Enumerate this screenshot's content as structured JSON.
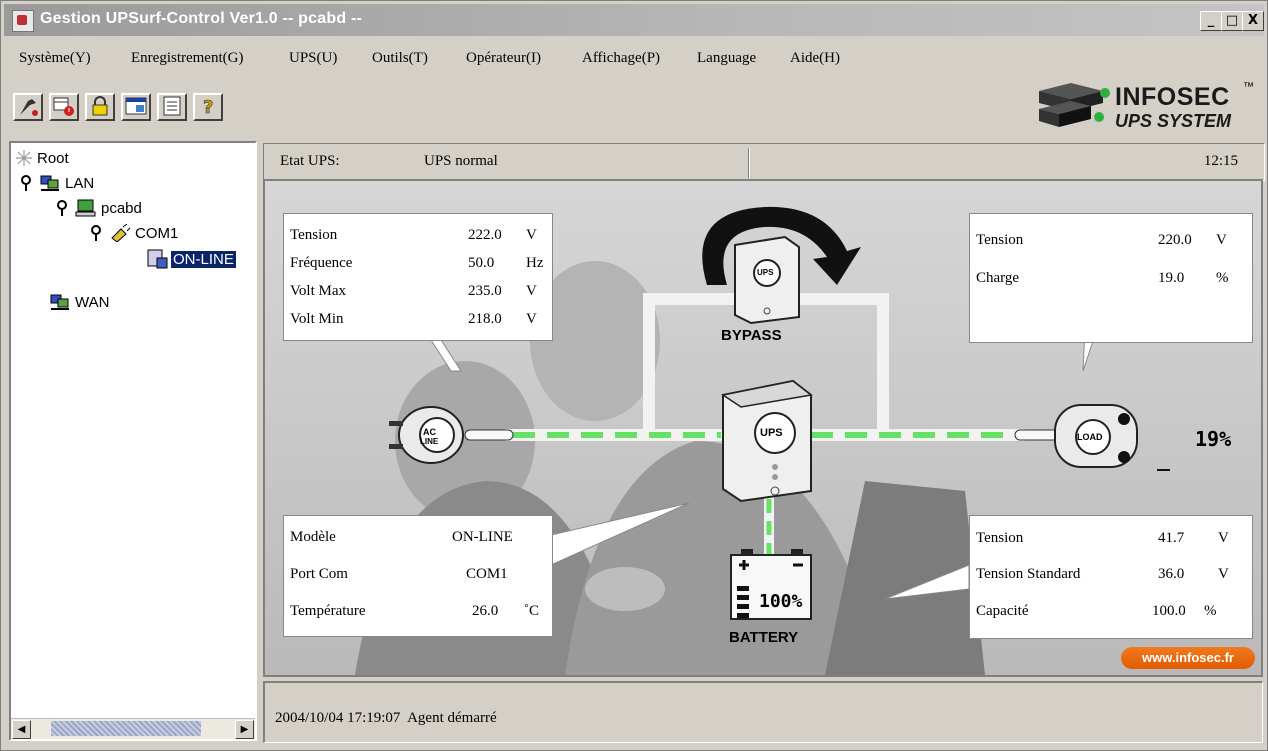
{
  "window": {
    "title": "Gestion UPSurf-Control Ver1.0 -- pcabd --",
    "buttons": [
      "_",
      "□",
      "X"
    ]
  },
  "menu": [
    "Système(Y)",
    "Enregistrement(G)",
    "UPS(U)",
    "Outils(T)",
    "Opérateur(I)",
    "Affichage(P)",
    "Language",
    "Aide(H)"
  ],
  "toolbar": [
    "tools-icon",
    "calendar-alarm-icon",
    "lock-icon",
    "window-icon",
    "list-icon",
    "help-icon"
  ],
  "logo": {
    "line1": "INFOSEC",
    "tm": "™",
    "line2": "UPS SYSTEM"
  },
  "tree": {
    "root": "Root",
    "lan": "LAN",
    "host": "pcabd",
    "port": "COM1",
    "device": "ON-LINE",
    "wan": "WAN"
  },
  "status": {
    "label": "Etat UPS:",
    "value": "UPS normal",
    "time": "12:15"
  },
  "input": {
    "rows": [
      {
        "label": "Tension",
        "value": "222.0",
        "unit": "V"
      },
      {
        "label": "Fréquence",
        "value": "50.0",
        "unit": "Hz"
      },
      {
        "label": "Volt Max",
        "value": "235.0",
        "unit": "V"
      },
      {
        "label": "Volt Min",
        "value": "218.0",
        "unit": "V"
      }
    ]
  },
  "output": {
    "rows": [
      {
        "label": "Tension",
        "value": "220.0",
        "unit": "V"
      },
      {
        "label": "Charge",
        "value": "19.0",
        "unit": "%"
      }
    ]
  },
  "ups_info": {
    "rows": [
      {
        "label": "Modèle",
        "value": "ON-LINE",
        "unit": ""
      },
      {
        "label": "Port Com",
        "value": "COM1",
        "unit": ""
      },
      {
        "label": "Température",
        "value": "26.0",
        "unit": "˚C"
      }
    ]
  },
  "battery_info": {
    "rows": [
      {
        "label": "Tension",
        "value": "41.7",
        "unit": "V"
      },
      {
        "label": "Tension Standard",
        "value": "36.0",
        "unit": "V"
      },
      {
        "label": "Capacité",
        "value": "100.0",
        "unit": "%"
      }
    ]
  },
  "diagram": {
    "ac_label1": "AC",
    "ac_label2": "LINE",
    "ups_label": "UPS",
    "bypass_label": "BYPASS",
    "battery_label": "BATTERY",
    "battery_percent": "100%",
    "load_label": "LOAD",
    "load_percent": "19%",
    "battery_level": 1.0,
    "load_level": 0.19
  },
  "website": "www.infosec.fr",
  "log": "2004/10/04 17:19:07  Agent démarré",
  "colors": {
    "flow": "#66e066",
    "selection": "#0a246a",
    "web_button": "#e35a00"
  }
}
